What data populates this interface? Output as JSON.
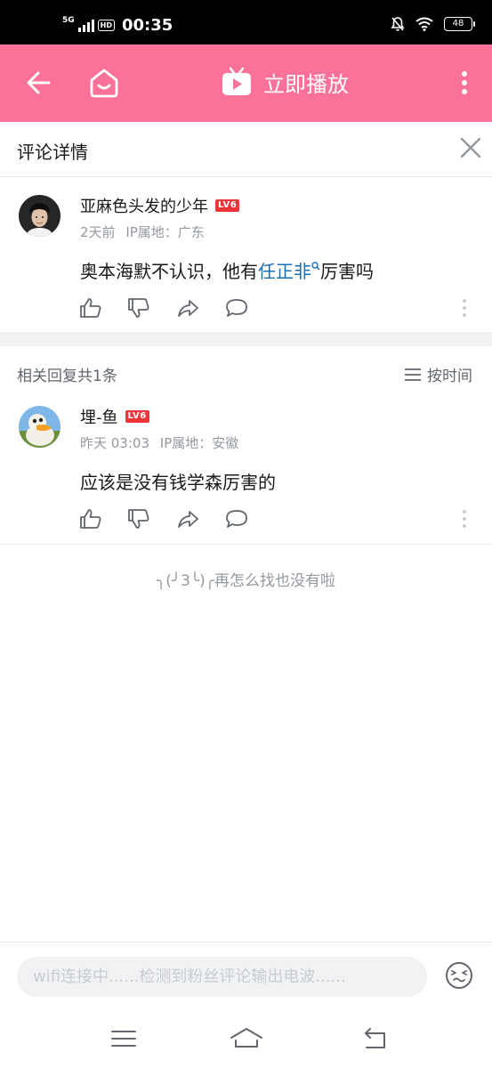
{
  "status_bar": {
    "network": "5G",
    "hd": "HD",
    "time": "00:35",
    "battery": "48"
  },
  "header": {
    "play_label": "立即播放",
    "icons": [
      "back-arrow-icon",
      "home-icon",
      "tv-play-icon",
      "more-vertical-icon"
    ],
    "bg_color": "#fb7299"
  },
  "detail": {
    "title": "评论详情"
  },
  "root_comment": {
    "username": "亚麻色头发的少年",
    "level": "LV6",
    "time": "2天前",
    "location": "IP属地：广东",
    "content_before": "奥本海默不认识，他有",
    "keyword": "任正非",
    "content_after": "厉害吗"
  },
  "replies": {
    "header": "相关回复共1条",
    "sort_label": "按时间",
    "items": [
      {
        "username": "埋-鱼",
        "level": "LV6",
        "time": "昨天 03:03",
        "location": "IP属地：安徽",
        "content": "应该是没有钱学森厉害的"
      }
    ]
  },
  "end_message": "╮(╯3╰)╭再怎么找也没有啦",
  "input": {
    "placeholder": "wifi连接中......检测到粉丝评论输出电波......"
  },
  "colors": {
    "accent": "#fb7299",
    "level_badge": "#f0353a",
    "link": "#1a6fb5",
    "meta_text": "#9499a0"
  }
}
